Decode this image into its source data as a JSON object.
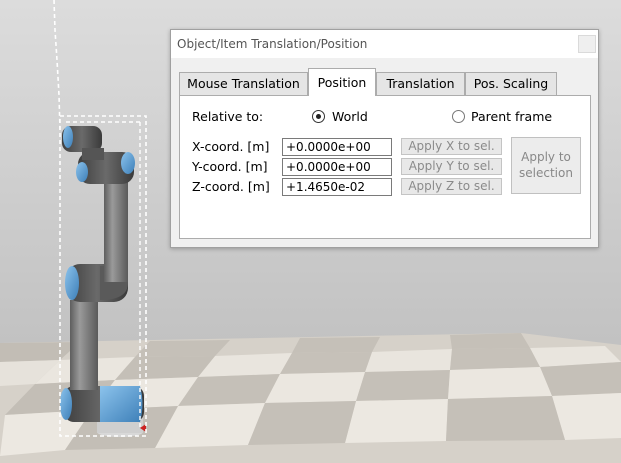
{
  "dialog": {
    "title": "Object/Item Translation/Position",
    "tabs": [
      {
        "label": "Mouse Translation",
        "active": false
      },
      {
        "label": "Position",
        "active": true
      },
      {
        "label": "Translation",
        "active": false
      },
      {
        "label": "Pos. Scaling",
        "active": false
      }
    ],
    "relative_to": {
      "label": "Relative to:",
      "options": [
        {
          "label": "World",
          "selected": true
        },
        {
          "label": "Parent frame",
          "selected": false
        }
      ]
    },
    "coords": [
      {
        "label": "X-coord. [m]",
        "value": "+0.0000e+00",
        "apply_label": "Apply X to sel."
      },
      {
        "label": "Y-coord. [m]",
        "value": "+0.0000e+00",
        "apply_label": "Apply Y to sel."
      },
      {
        "label": "Z-coord. [m]",
        "value": "+1.4650e-02",
        "apply_label": "Apply Z to sel."
      }
    ],
    "apply_all": {
      "line1": "Apply to",
      "line2": "selection"
    }
  },
  "colors": {
    "robot_accent": "#5b9bd5",
    "robot_grey": "#7a7a7a",
    "selection_box": "#ffffff"
  }
}
